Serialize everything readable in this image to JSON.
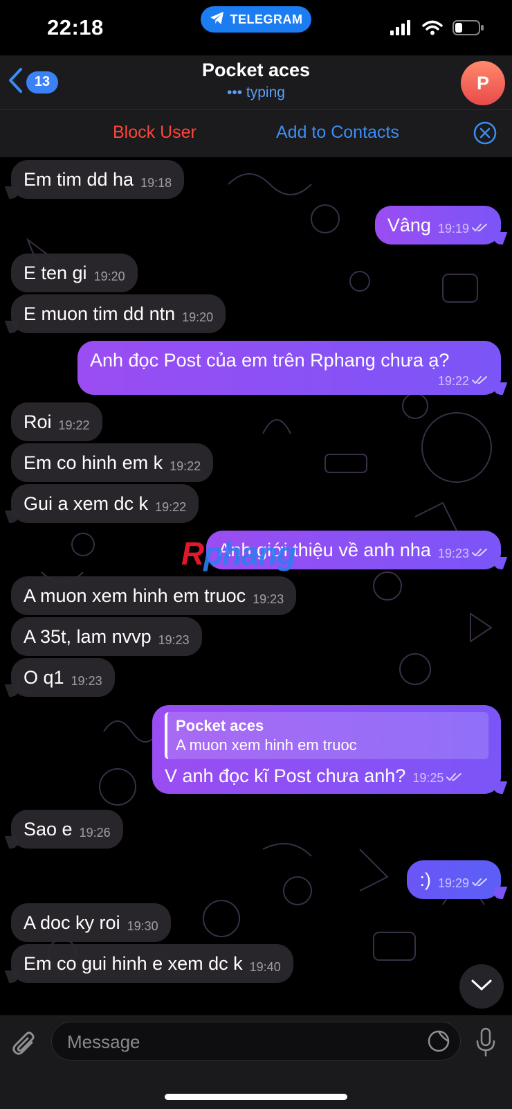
{
  "status_bar": {
    "time": "22:18",
    "app_pill": "TELEGRAM"
  },
  "header": {
    "back_count": "13",
    "title": "Pocket aces",
    "status": "••• typing",
    "avatar_initial": "P",
    "block_user": "Block User",
    "add_contacts": "Add to Contacts"
  },
  "watermark": {
    "r": "R",
    "rest": "phang"
  },
  "messages": [
    {
      "dir": "in",
      "text": "Em tim dd ha",
      "time": "19:18"
    },
    {
      "dir": "out",
      "text": "Vâng",
      "time": "19:19"
    },
    {
      "dir": "in",
      "text": "E ten gi",
      "time": "19:20"
    },
    {
      "dir": "in",
      "text": "E muon tim dd ntn",
      "time": "19:20"
    },
    {
      "dir": "out",
      "text": "Anh đọc Post của em trên Rphang chưa ạ?",
      "time": "19:22"
    },
    {
      "dir": "in",
      "text": "Roi",
      "time": "19:22"
    },
    {
      "dir": "in",
      "text": "Em co hinh em k",
      "time": "19:22"
    },
    {
      "dir": "in",
      "text": "Gui a xem dc k",
      "time": "19:22"
    },
    {
      "dir": "out",
      "text": "Anh giới thiệu về anh nha",
      "time": "19:23"
    },
    {
      "dir": "in",
      "text": "A muon xem hinh em truoc",
      "time": "19:23"
    },
    {
      "dir": "in",
      "text": "A 35t, lam nvvp",
      "time": "19:23"
    },
    {
      "dir": "in",
      "text": "O q1",
      "time": "19:23"
    },
    {
      "dir": "out",
      "text": "V anh đọc kĩ Post chưa anh?",
      "time": "19:25",
      "reply_name": "Pocket aces",
      "reply_text": "A muon xem hinh em truoc"
    },
    {
      "dir": "in",
      "text": "Sao e",
      "time": "19:26"
    },
    {
      "dir": "out",
      "text": ":)",
      "time": "19:29"
    },
    {
      "dir": "in",
      "text": "A doc ky roi",
      "time": "19:30"
    },
    {
      "dir": "in",
      "text": "Em co gui hinh e xem dc k",
      "time": "19:40"
    }
  ],
  "composer": {
    "placeholder": "Message"
  },
  "colors": {
    "accent_blue": "#3b8df5",
    "block_red": "#ff453a",
    "outgoing_start": "#9a4df2",
    "outgoing_end": "#7b55f7",
    "incoming": "#2c282e"
  },
  "icons": [
    "telegram-icon",
    "signal-icon",
    "wifi-icon",
    "battery-icon",
    "back-chevron-icon",
    "close-circle-icon",
    "double-check-icon",
    "chevron-down-icon",
    "paperclip-icon",
    "sticker-icon",
    "microphone-icon"
  ]
}
